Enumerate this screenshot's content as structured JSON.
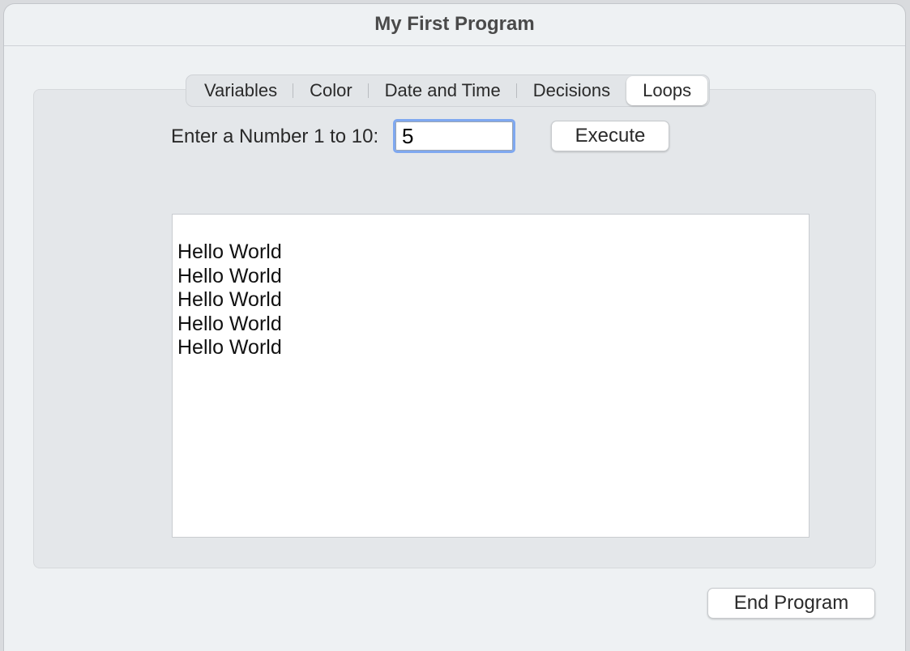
{
  "window": {
    "title": "My First Program"
  },
  "tabs": [
    {
      "label": "Variables",
      "selected": false
    },
    {
      "label": "Color",
      "selected": false
    },
    {
      "label": "Date and Time",
      "selected": false
    },
    {
      "label": "Decisions",
      "selected": false
    },
    {
      "label": "Loops",
      "selected": true
    }
  ],
  "loops_tab": {
    "prompt_label": "Enter a Number 1 to 10:",
    "number_value": "5",
    "execute_label": "Execute",
    "output_lines": [
      "Hello World",
      "Hello World",
      "Hello World",
      "Hello World",
      "Hello World"
    ]
  },
  "footer": {
    "end_label": "End Program"
  },
  "colors": {
    "focus_ring": "#7fa8f0",
    "window_bg": "#eef1f3",
    "panel_bg": "#e4e7ea"
  }
}
